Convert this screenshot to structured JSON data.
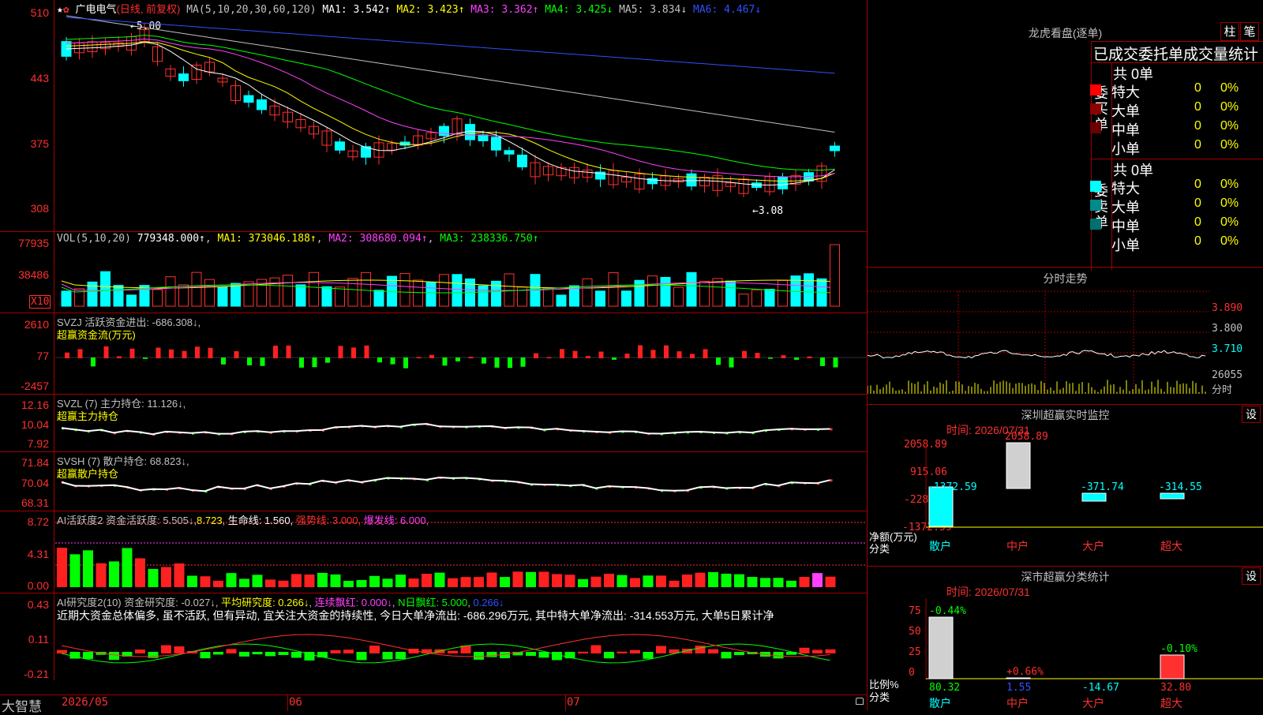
{
  "stock": {
    "name": "广电电气",
    "mode": "(日线, 前复权)",
    "ma_label": "MA(5,10,20,30,60,120)",
    "ma1": "MA1: 3.542↑",
    "ma2": "MA2: 3.423↑",
    "ma3": "MA3: 3.362↑",
    "ma4": "MA4: 3.425↓",
    "ma5": "MA5: 3.834↓",
    "ma6": "MA6: 4.467↓",
    "high_mark": "←5.00",
    "low_mark": "←3.08",
    "price_ticks": [
      "510",
      "443",
      "375",
      "308"
    ]
  },
  "vol": {
    "label": "VOL(5,10,20)",
    "value": "779348.000↑",
    "ma1": "MA1: 373046.188↑",
    "ma2": "MA2: 308680.094↑",
    "ma3": "MA3: 238336.750↑",
    "ticks": [
      "77935",
      "38486"
    ],
    "unit": "X10"
  },
  "svzj": {
    "label": "SVZJ  活跃资金进出: -686.308↓,",
    "sub": "超赢资金流(万元)",
    "ticks": [
      "2610",
      "77",
      "-2457"
    ]
  },
  "svzl": {
    "label": "SVZL (7) 主力持仓: 11.126↓,",
    "sub": "超赢主力持仓",
    "ticks": [
      "12.16",
      "10.04",
      "7.92"
    ]
  },
  "svsh": {
    "label": "SVSH (7) 散户持仓: 68.823↓,",
    "sub": "超赢散户持仓",
    "ticks": [
      "71.84",
      "70.04",
      "68.31"
    ]
  },
  "ai_active": {
    "label": "AI活跃度2 资金活跃度: 5.505↓",
    "v2": "8.723",
    "life": "生命线: 1.560,",
    "strong": "强势线: 3.000,",
    "burst": "爆发线: 6.000,",
    "ticks": [
      "8.72",
      "4.31",
      "0.00"
    ]
  },
  "ai_research": {
    "label": "AI研究度2(10) 资金研究度: -0.027↓",
    "avg": "平均研究度: 0.266↓",
    "streak": "连续飘红: 0.000↓",
    "nday": "N日飘红: 5.000",
    "v5": "0.266↓",
    "comment": "近期大资金总体偏多, 虽不活跃, 但有异动, 宜关注大资金的持续性, 今日大单净流出: -686.296万元, 其中特大单净流出: -314.553万元, 大单5日累计净",
    "ticks": [
      "0.43",
      "0.11",
      "-0.21"
    ]
  },
  "bottom": {
    "brand": "大智慧",
    "dates": [
      "2026/05",
      "06",
      "07"
    ]
  },
  "right": {
    "lhb_title": "龙虎看盘(逐单)",
    "btn_zhu": "柱",
    "btn_bi": "笔",
    "tabs_title": "已成交委托单成交量统计",
    "buy_label": "委买单",
    "sell_label": "委卖单",
    "buy_total": "共 0单",
    "sell_total": "共 0单",
    "buy_rows": [
      {
        "name": "特大",
        "count": "0",
        "pct": "0%",
        "color": "#ff0000"
      },
      {
        "name": "大单",
        "count": "0",
        "pct": "0%",
        "color": "#8b0000"
      },
      {
        "name": "中单",
        "count": "0",
        "pct": "0%",
        "color": "#6b0000"
      },
      {
        "name": "小单",
        "count": "0",
        "pct": "0%",
        "color": ""
      }
    ],
    "sell_rows": [
      {
        "name": "特大",
        "count": "0",
        "pct": "0%",
        "color": "#00ffff"
      },
      {
        "name": "大单",
        "count": "0",
        "pct": "0%",
        "color": "#008b8b"
      },
      {
        "name": "中单",
        "count": "0",
        "pct": "0%",
        "color": "#007070"
      },
      {
        "name": "小单",
        "count": "0",
        "pct": "0%",
        "color": ""
      }
    ],
    "intraday_title": "分时走势",
    "intraday_ticks": [
      "3.890",
      "3.800",
      "3.710",
      "26055",
      "分时"
    ],
    "sz_monitor_title": "深圳超赢实时监控",
    "sz_monitor_btn": "设",
    "time_label": "时间: 2026/07/31",
    "monitor_ticks": [
      "2058.89",
      "915.06",
      "-228.77",
      "-1372.59"
    ],
    "monitor_yunit": "净额(万元)",
    "monitor_xunit": "分类",
    "monitor_values": [
      "-1372.59",
      "2058.89",
      "-371.74",
      "-314.55"
    ],
    "categories": [
      "散户",
      "中户",
      "大户",
      "超大"
    ],
    "class_title": "深市超赢分类统计",
    "class_btn": "设",
    "class_time": "时间: 2026/07/31",
    "class_ticks": [
      "75",
      "50",
      "25",
      "0"
    ],
    "class_yunit": "比例%",
    "class_xunit": "分类",
    "class_top": [
      "-0.44%",
      "+0.66%",
      "",
      "-0.10%"
    ],
    "class_bottom": [
      "80.32",
      "1.55",
      "-14.67",
      "32.80"
    ]
  }
}
